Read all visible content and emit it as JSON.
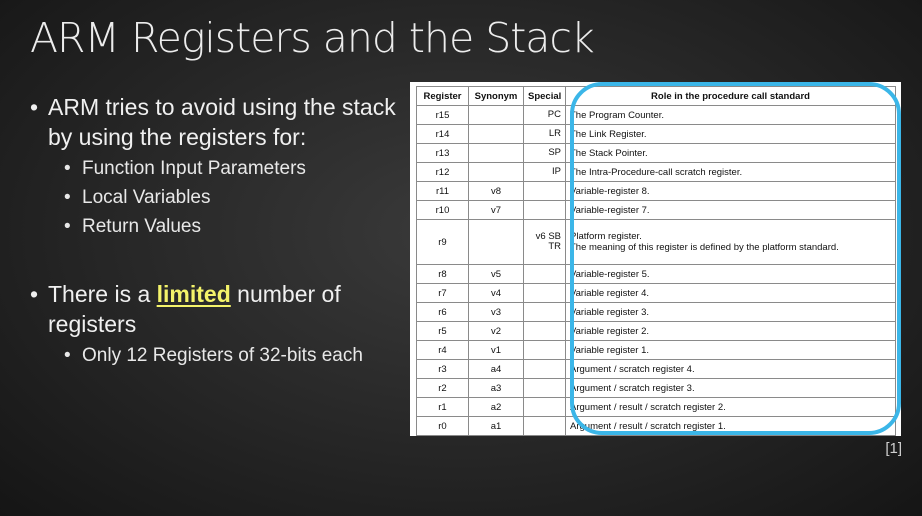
{
  "title": "ARM Registers and the Stack",
  "bullets": {
    "main1": "ARM tries to avoid using the stack by using the registers for:",
    "sub1": [
      "Function Input Parameters",
      "Local Variables",
      "Return Values"
    ],
    "main2_pre": "There is a ",
    "main2_highlight": "limited",
    "main2_post": " number of registers",
    "sub2": [
      "Only 12 Registers of 32-bits each"
    ]
  },
  "table": {
    "headers": [
      "Register",
      "Synonym",
      "Special",
      "Role in the procedure call standard"
    ],
    "rows": [
      {
        "reg": "r15",
        "syn": "",
        "special": "PC",
        "role": "The Program Counter."
      },
      {
        "reg": "r14",
        "syn": "",
        "special": "LR",
        "role": "The Link Register."
      },
      {
        "reg": "r13",
        "syn": "",
        "special": "SP",
        "role": "The Stack Pointer."
      },
      {
        "reg": "r12",
        "syn": "",
        "special": "IP",
        "role": "The Intra-Procedure-call scratch register."
      },
      {
        "reg": "r11",
        "syn": "v8",
        "special": "",
        "role": "Variable-register 8."
      },
      {
        "reg": "r10",
        "syn": "v7",
        "special": "",
        "role": "Variable-register 7."
      },
      {
        "reg": "r9",
        "syn": "",
        "special": "v6 SB TR",
        "role": "Platform register.",
        "role2": "The meaning of this register is defined by the platform standard."
      },
      {
        "reg": "r8",
        "syn": "v5",
        "special": "",
        "role": "Variable-register 5."
      },
      {
        "reg": "r7",
        "syn": "v4",
        "special": "",
        "role": "Variable register 4."
      },
      {
        "reg": "r6",
        "syn": "v3",
        "special": "",
        "role": "Variable register 3."
      },
      {
        "reg": "r5",
        "syn": "v2",
        "special": "",
        "role": "Variable register 2."
      },
      {
        "reg": "r4",
        "syn": "v1",
        "special": "",
        "role": "Variable register 1."
      },
      {
        "reg": "r3",
        "syn": "a4",
        "special": "",
        "role": "Argument / scratch register 4."
      },
      {
        "reg": "r2",
        "syn": "a3",
        "special": "",
        "role": "Argument / scratch register 3."
      },
      {
        "reg": "r1",
        "syn": "a2",
        "special": "",
        "role": "Argument / result / scratch register 2."
      },
      {
        "reg": "r0",
        "syn": "a1",
        "special": "",
        "role": "Argument / result / scratch register 1."
      }
    ]
  },
  "citation": "[1]",
  "colors": {
    "highlight": "#f4f36a",
    "annotation": "#3bb6e8"
  }
}
